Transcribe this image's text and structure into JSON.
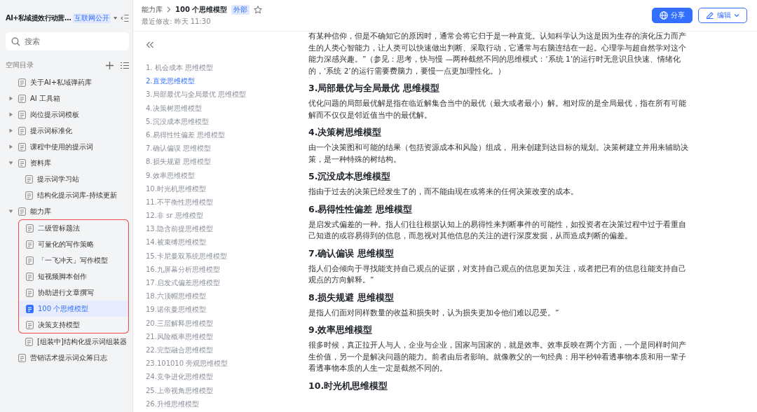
{
  "sidebar": {
    "space_title": "AI+私域提效行动营...",
    "space_badge": "互联网公开",
    "search": {
      "placeholder": "搜索"
    },
    "section_title": "空间目录",
    "tree": [
      {
        "label": "关于AI+私域弹药库",
        "selected": false
      },
      {
        "label": "AI 工具箱",
        "selected": false,
        "expanded": false
      },
      {
        "label": "岗位提示词模板",
        "selected": false,
        "expanded": false
      },
      {
        "label": "提示词标准化",
        "selected": false,
        "expanded": false
      },
      {
        "label": "课程中使用的提示词",
        "selected": false,
        "expanded": false
      },
      {
        "label": "资料库",
        "selected": false,
        "expanded": true,
        "children": [
          {
            "label": "提示词学习站",
            "selected": false,
            "highlighted": false
          },
          {
            "label": "结构化提示词库-持续更新",
            "selected": false,
            "highlighted": false
          }
        ]
      },
      {
        "label": "能力库",
        "selected": false,
        "expanded": true,
        "children": [
          {
            "label": "二级管标题法",
            "selected": false,
            "highlighted": true
          },
          {
            "label": "可量化的写作策略",
            "selected": false,
            "highlighted": true
          },
          {
            "label": "「一飞冲天」写作模型",
            "selected": false,
            "highlighted": true
          },
          {
            "label": "短视频脚本创作",
            "selected": false,
            "highlighted": true
          },
          {
            "label": "协助进行文章撰写",
            "selected": false,
            "highlighted": true
          },
          {
            "label": "100 个思维模型",
            "selected": true,
            "highlighted": true
          },
          {
            "label": "决策支持模型",
            "selected": false,
            "highlighted": true
          },
          {
            "label": "[组装中]结构化提示词组装器",
            "selected": false,
            "highlighted": false
          }
        ]
      },
      {
        "label": "营销话术提示词众筹日志",
        "selected": false
      }
    ]
  },
  "header": {
    "breadcrumb": [
      "能力库",
      "100 个思维模型"
    ],
    "badge": "外部",
    "modified": "最近修改: 昨天 11:30",
    "share_button": "分享",
    "edit_button": "编辑"
  },
  "toc": [
    {
      "label": "1. 机会成本 思维模型",
      "selected": false
    },
    {
      "label": "2.直觉思维模型",
      "selected": true
    },
    {
      "label": "3.局部最优与全局最优 思维模型",
      "selected": false
    },
    {
      "label": "4.决策树思维模型",
      "selected": false
    },
    {
      "label": "5.沉没成本思维模型",
      "selected": false
    },
    {
      "label": "6.易得性性偏差 思维模型",
      "selected": false
    },
    {
      "label": "7.确认偏误 思维模型",
      "selected": false
    },
    {
      "label": "8.损失规避 思维模型",
      "selected": false
    },
    {
      "label": "9.效率思维模型",
      "selected": false
    },
    {
      "label": "10.时光机思维模型",
      "selected": false
    },
    {
      "label": "11.不平衡性思维模型",
      "selected": false
    },
    {
      "label": "12.非 sr 思维模型",
      "selected": false
    },
    {
      "label": "13.隐含前提思维模型",
      "selected": false
    },
    {
      "label": "14.被束缚思维模型",
      "selected": false
    },
    {
      "label": "15.卡尼曼双系统思维模型",
      "selected": false
    },
    {
      "label": "16.九屏幕分析思维模型",
      "selected": false
    },
    {
      "label": "17.启发式偏差思维模型",
      "selected": false
    },
    {
      "label": "18.六顶帽思维模型",
      "selected": false
    },
    {
      "label": "19.诺依曼思维模型",
      "selected": false
    },
    {
      "label": "20.三层解释思维模型",
      "selected": false
    },
    {
      "label": "21.风险概率思维模型",
      "selected": false
    },
    {
      "label": "22.完型融合思维模型",
      "selected": false
    },
    {
      "label": "23.101010 旁观思维模型",
      "selected": false
    },
    {
      "label": "24.竞争进化思维模型",
      "selected": false
    },
    {
      "label": "25.上帝视角思维模型",
      "selected": false
    },
    {
      "label": "26.升维思维模型",
      "selected": false
    }
  ],
  "content": [
    {
      "kind": "paragraph",
      "text": "有某种信仰，但是不确知它的原因时，通常会将它归于是一种直觉。认知科学认为这是因为生存的演化压力而产生的人类心智能力，让人类可以快速做出判断、采取行动，它通常与右脑连结在一起。心理学与超自然学对这个能力深感兴趣。”（参见：思考，快与慢 —两种截然不同的思维模式：‘系统 1’的运行时无意识且快速、情绪化的，‘系统 2’的运行需要费脑力，要慢一点更加理性化。）"
    },
    {
      "kind": "heading",
      "text": "3.局部最优与全局最优 思维模型"
    },
    {
      "kind": "paragraph",
      "text": "优化问题的局部最优解是指在临近解集合当中的最优（最大或者最小）解。相对应的是全局最优，指在所有可能解而不仅仅是邻近值当中的最优解。"
    },
    {
      "kind": "heading",
      "text": "4.决策树思维模型"
    },
    {
      "kind": "paragraph",
      "text": "由一个决策图和可能的结果（包括资源成本和风险）组成， 用来创建到达目标的规划。决策树建立并用来辅助决策，是一种特殊的树结构。"
    },
    {
      "kind": "heading",
      "text": "5.沉没成本思维模型"
    },
    {
      "kind": "paragraph",
      "text": "指由于过去的决策已经发生了的，而不能由现在或将来的任何决策改变的成本。"
    },
    {
      "kind": "heading",
      "text": "6.易得性性偏差 思维模型"
    },
    {
      "kind": "paragraph",
      "text": "是启发式偏差的一种。指人们往往根据认知上的易得性来判断事件的可能性，如投资者在决策过程中过于看重自己知道的或容易得到的信息，而忽视对其他信息的关注的进行深度发掘，从而造成判断的偏差。"
    },
    {
      "kind": "heading",
      "text": "7.确认偏误 思维模型"
    },
    {
      "kind": "paragraph",
      "text": "指人们会倾向于寻找能支持自己观点的证据，对支持自己观点的信息更加关注，或者把已有的信息往能支持自己观点的方向解释。”"
    },
    {
      "kind": "heading",
      "text": "8.损失规避 思维模型"
    },
    {
      "kind": "paragraph",
      "text": "是指人们面对同样数量的收益和损失时，认为损失更加令他们难以忍受。”"
    },
    {
      "kind": "heading",
      "text": "9.效率思维模型"
    },
    {
      "kind": "paragraph",
      "text": "很多时候，真正拉开人与人，企业与企业，国家与国家的，就是效率。效率反映在两个方面，一个是同样时间产生价值，另一个是解决问题的能力。前者由后者影响。就像教父的一句经典：用半秒钟看透事物本质和用一辈子看透事物本质的人生一定是截然不同的。"
    },
    {
      "kind": "heading",
      "text": "10.时光机思维模型"
    }
  ]
}
